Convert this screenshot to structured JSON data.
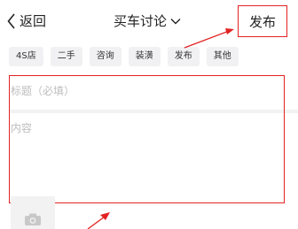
{
  "header": {
    "back_label": "返回",
    "title": "买车讨论",
    "publish_label": "发布"
  },
  "tags": [
    "4S店",
    "二手",
    "咨询",
    "装潢",
    "发布",
    "其他"
  ],
  "form": {
    "title_placeholder": "标题（必填）",
    "content_placeholder": "内容"
  },
  "icons": {
    "back": "chevron-left-icon",
    "title_dropdown": "chevron-down-icon",
    "photo": "camera-icon"
  },
  "colors": {
    "annotation_red": "#e32222"
  }
}
